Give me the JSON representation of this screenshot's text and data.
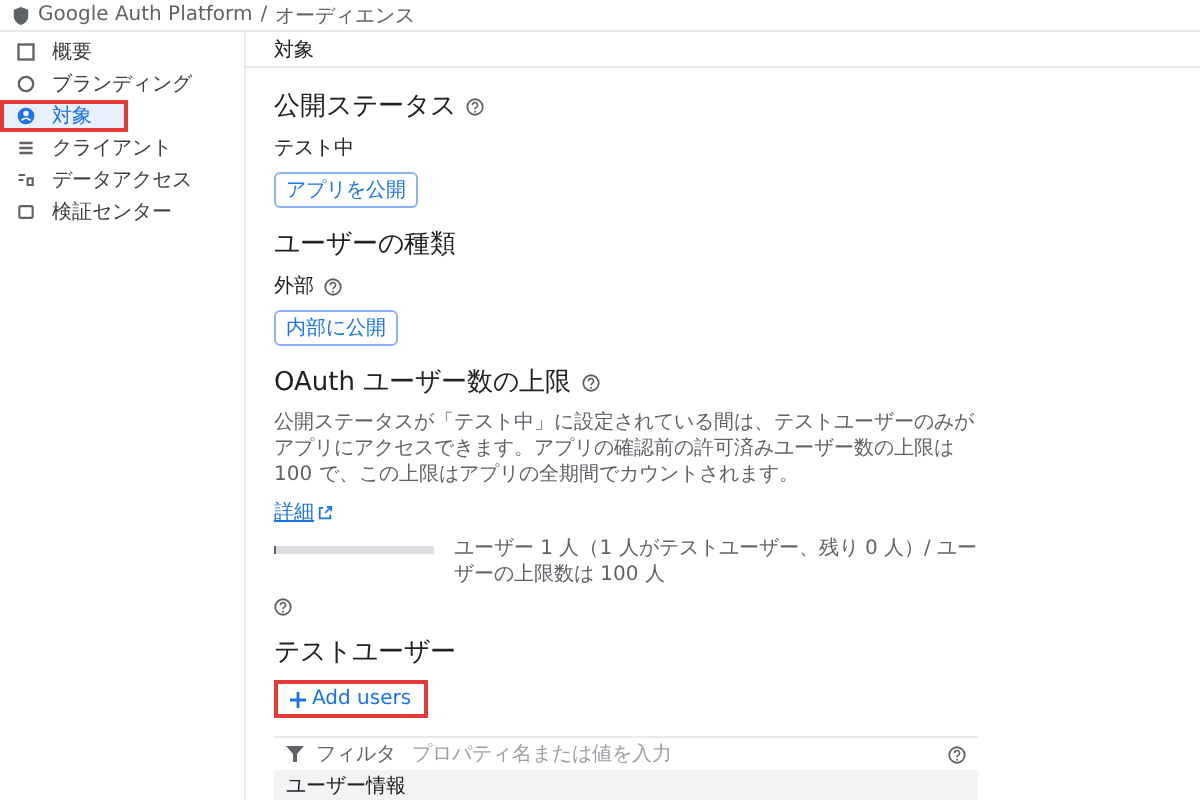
{
  "breadcrumb": {
    "product": "Google Auth Platform",
    "separator": "/",
    "page": "オーディエンス"
  },
  "sidebar": {
    "items": [
      {
        "label": "概要",
        "selected": false,
        "highlighted": false
      },
      {
        "label": "ブランディング",
        "selected": false,
        "highlighted": false
      },
      {
        "label": "対象",
        "selected": true,
        "highlighted": true
      },
      {
        "label": "クライアント",
        "selected": false,
        "highlighted": false
      },
      {
        "label": "データアクセス",
        "selected": false,
        "highlighted": false
      },
      {
        "label": "検証センター",
        "selected": false,
        "highlighted": false
      }
    ]
  },
  "page_title": "対象",
  "publish_status": {
    "heading": "公開ステータス",
    "status": "テスト中",
    "button": "アプリを公開"
  },
  "user_type": {
    "heading": "ユーザーの種類",
    "value": "外部",
    "button": "内部に公開"
  },
  "user_cap": {
    "heading": "OAuth ユーザー数の上限",
    "description": "公開ステータスが「テスト中」に設定されている間は、テストユーザーのみがアプリにアクセスできます。アプリの確認前の許可済みユーザー数の上限は 100 で、この上限はアプリの全期間でカウントされます。",
    "link": "詳細",
    "level": 0.01,
    "reading": "ユーザー 1 人（1 人がテストユーザー、残り 0 人）/ ユーザーの上限数は 100 人"
  },
  "test_users": {
    "heading": "テストユーザー",
    "add_button": "Add users",
    "add_button_highlighted": true,
    "filter_label": "フィルタ",
    "filter_placeholder": "プロパティ名または値を入力",
    "columns": [
      "ユーザー情報"
    ]
  }
}
